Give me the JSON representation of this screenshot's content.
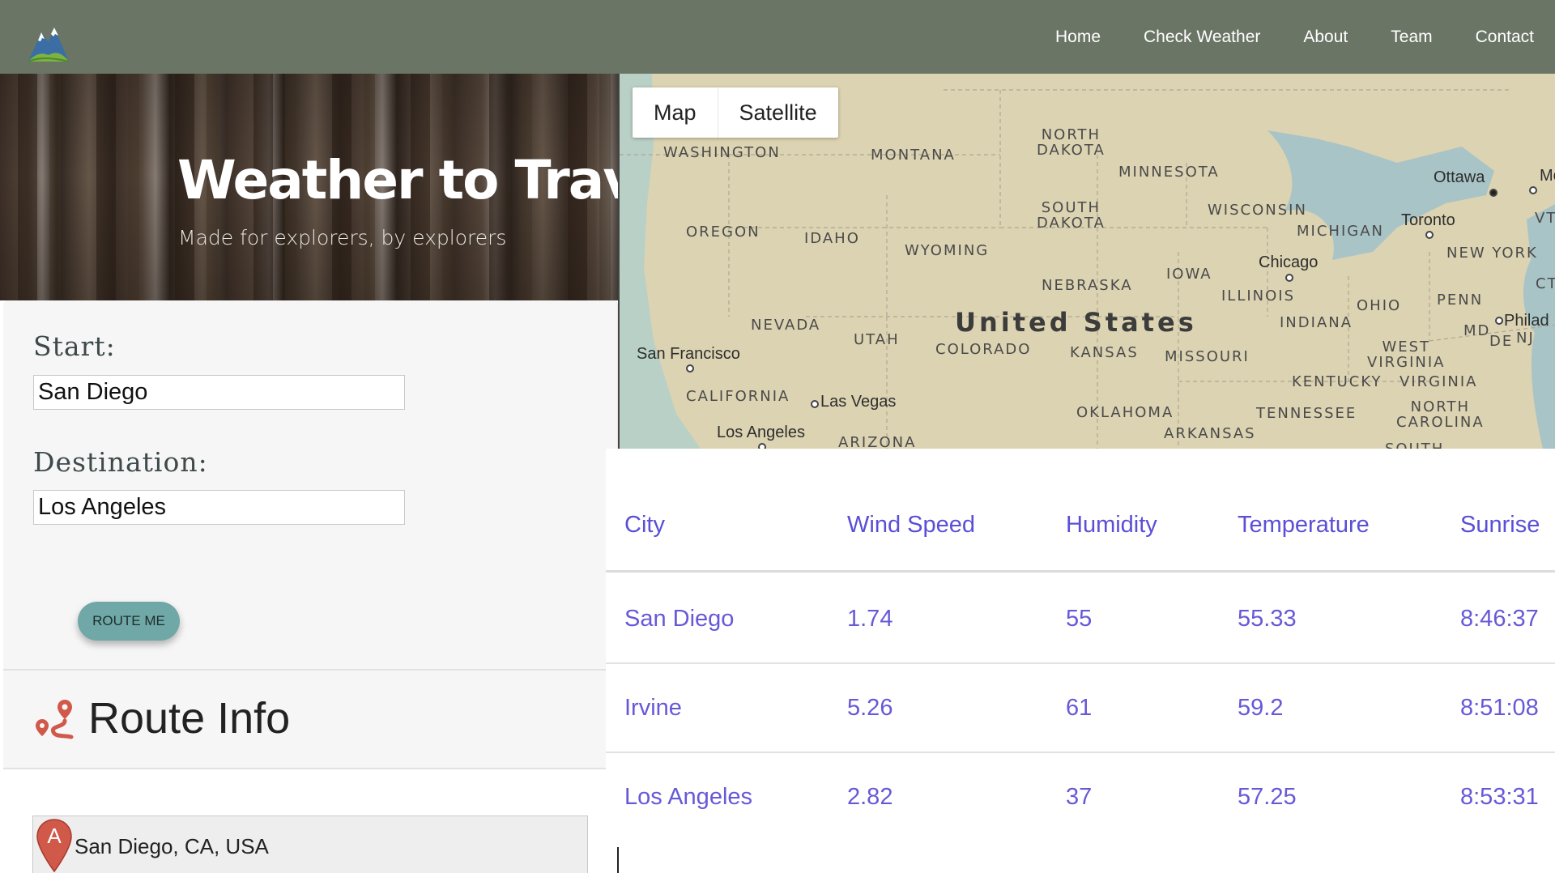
{
  "nav": {
    "logo_icon": "mountain-logo-icon",
    "links": [
      "Home",
      "Check Weather",
      "About",
      "Team",
      "Contact"
    ]
  },
  "hero": {
    "title": "Weather to Travel",
    "subtitle": "Made for explorers, by explorers"
  },
  "form": {
    "start_label": "Start:",
    "start_value": "San Diego",
    "destination_label": "Destination:",
    "destination_value": "Los Angeles",
    "route_button": "ROUTE ME"
  },
  "route_info": {
    "title": "Route Info",
    "icon": "route-icon",
    "legs": [
      {
        "marker": "A",
        "address": "San Diego, CA, USA"
      }
    ]
  },
  "map": {
    "type_buttons": [
      "Map",
      "Satellite"
    ],
    "country": "United States",
    "states": [
      "WASHINGTON",
      "MONTANA",
      "NORTH\nDAKOTA",
      "MINNESOTA",
      "SOUTH\nDAKOTA",
      "WISCONSIN",
      "MICHIGAN",
      "OREGON",
      "IDAHO",
      "WYOMING",
      "IOWA",
      "NEBRASKA",
      "ILLINOIS",
      "NEW YORK",
      "OHIO",
      "PENN",
      "INDIANA",
      "NEVADA",
      "UTAH",
      "COLORADO",
      "KANSAS",
      "MISSOURI",
      "MD",
      "DE",
      "NJ",
      "WEST\nVIRGINIA",
      "VIRGINIA",
      "KENTUCKY",
      "CALIFORNIA",
      "OKLAHOMA",
      "TENNESSEE",
      "NORTH\nCAROLINA",
      "ARKANSAS",
      "ARIZONA",
      "VT",
      "CT",
      "SOUTH"
    ],
    "cities": [
      "Ottawa",
      "Toronto",
      "Chicago",
      "San Francisco",
      "Las Vegas",
      "Los Angeles",
      "Philad",
      "Mo",
      "M"
    ]
  },
  "table": {
    "headers": [
      "City",
      "Wind Speed",
      "Humidity",
      "Temperature",
      "Sunrise"
    ],
    "rows": [
      [
        "San Diego",
        "1.74",
        "55",
        "55.33",
        "8:46:37"
      ],
      [
        "Irvine",
        "5.26",
        "61",
        "59.2",
        "8:51:08"
      ],
      [
        "Los Angeles",
        "2.82",
        "37",
        "57.25",
        "8:53:31"
      ]
    ]
  },
  "colors": {
    "navbar": "#6b7565",
    "table_text": "#5a4fd6",
    "route_button": "#6fa8a6",
    "route_icon": "#d0594a"
  }
}
